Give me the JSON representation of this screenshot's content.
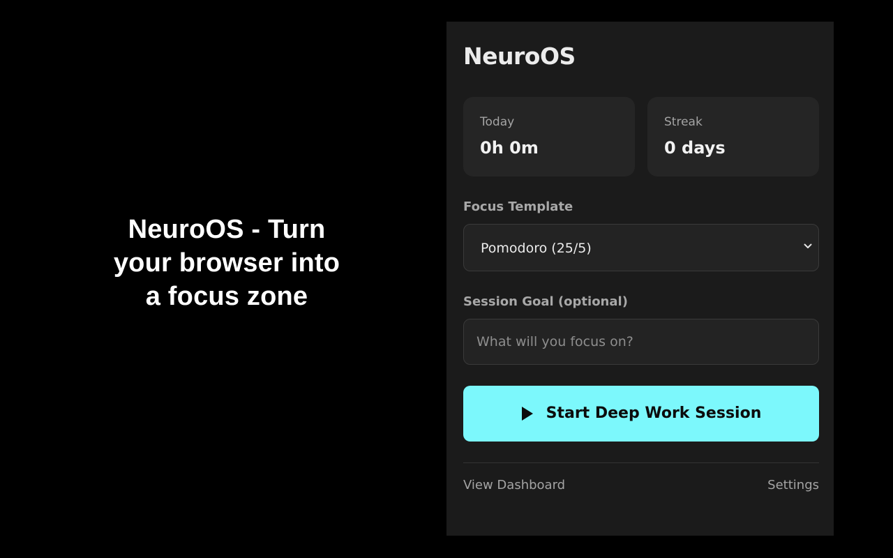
{
  "promo": {
    "headline": "NeuroOS - Turn your browser into a focus zone"
  },
  "app": {
    "title": "NeuroOS"
  },
  "stats": {
    "today": {
      "label": "Today",
      "value": "0h 0m"
    },
    "streak": {
      "label": "Streak",
      "value": "0 days"
    }
  },
  "template": {
    "label": "Focus Template",
    "selected": "Pomodoro (25/5)",
    "icon": "chevron-down-icon"
  },
  "goal": {
    "label": "Session Goal (optional)",
    "placeholder": "What will you focus on?",
    "value": ""
  },
  "start": {
    "label": "Start Deep Work Session",
    "icon": "play-icon"
  },
  "footer": {
    "dashboard_label": "View Dashboard",
    "settings_label": "Settings"
  },
  "colors": {
    "background": "#000000",
    "panel": "#1b1b1b",
    "card": "#252525",
    "accent": "#7cf8fc",
    "text_primary": "#ececec",
    "text_muted": "#a4a4a4"
  }
}
